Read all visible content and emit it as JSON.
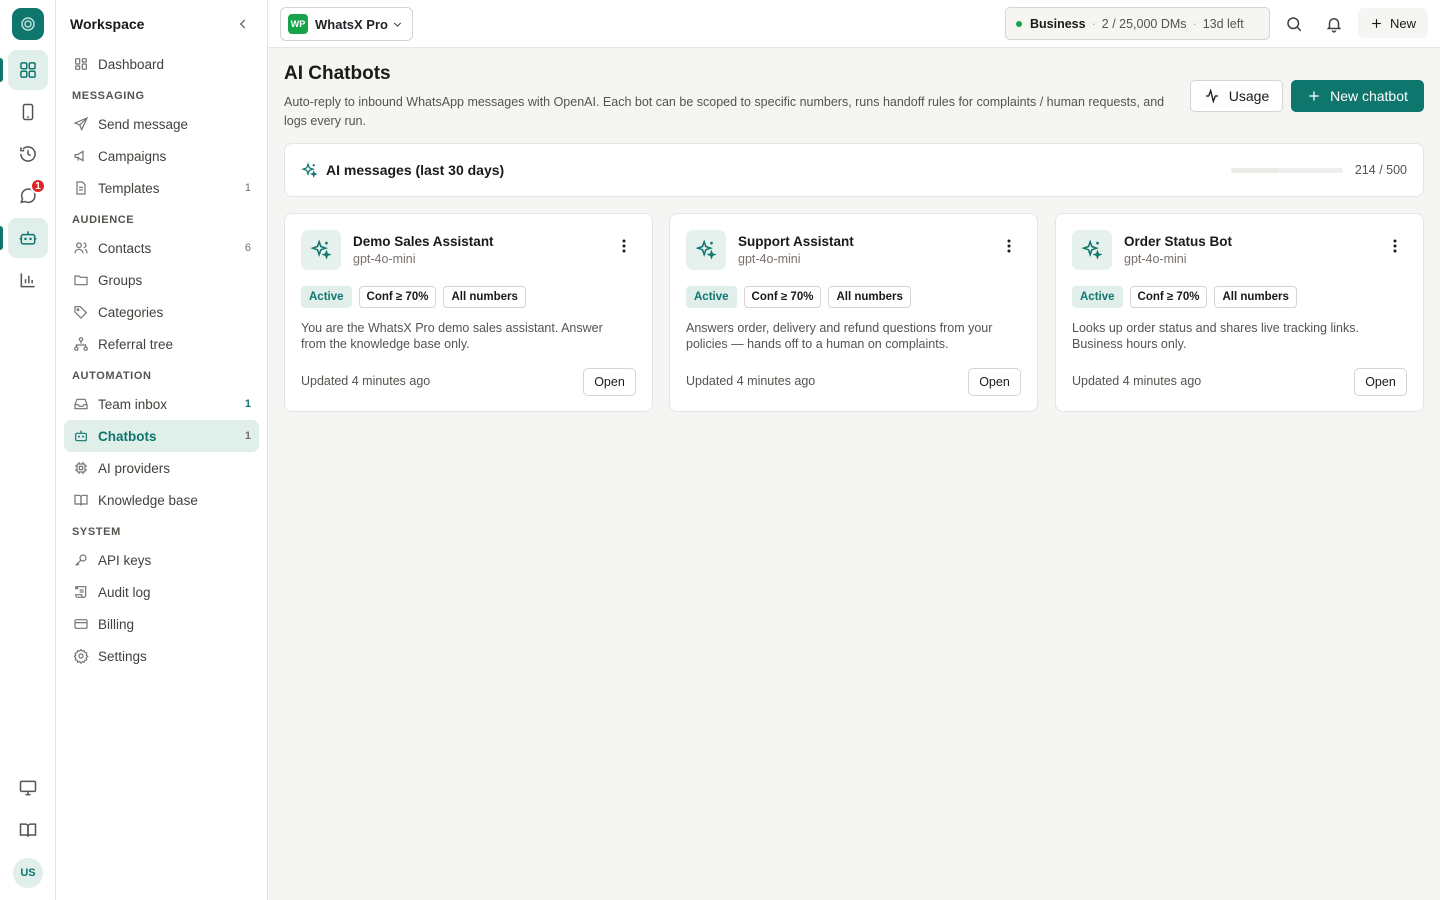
{
  "rail": {
    "badge_count": "1",
    "avatar_initials": "US",
    "items": [
      {
        "icon": "dashboard-grid-icon"
      },
      {
        "icon": "phone-device-icon"
      },
      {
        "icon": "history-icon"
      },
      {
        "icon": "chat-icon"
      },
      {
        "icon": "bot-icon"
      },
      {
        "icon": "bar-chart-icon"
      }
    ]
  },
  "sidebar": {
    "title": "Workspace",
    "dashboard": "Dashboard",
    "sections": {
      "messaging": "MESSAGING",
      "audience": "AUDIENCE",
      "automation": "AUTOMATION",
      "system": "SYSTEM"
    },
    "items": {
      "send_message": "Send message",
      "campaigns": "Campaigns",
      "templates": "Templates",
      "templates_count": "1",
      "contacts": "Contacts",
      "contacts_count": "6",
      "groups": "Groups",
      "categories": "Categories",
      "referral_tree": "Referral tree",
      "team_inbox": "Team inbox",
      "team_inbox_count": "1",
      "chatbots": "Chatbots",
      "chatbots_count": "1",
      "ai_providers": "AI providers",
      "knowledge_base": "Knowledge base",
      "api_keys": "API keys",
      "audit_log": "Audit log",
      "billing": "Billing",
      "settings": "Settings"
    }
  },
  "topbar": {
    "workspace_logo": "WP",
    "workspace_name": "WhatsX Pro",
    "plan_name": "Business",
    "plan_dms": "2 / 25,000 DMs",
    "plan_left": "13d left",
    "new_label": "New"
  },
  "page": {
    "title": "AI Chatbots",
    "description": "Auto-reply to inbound WhatsApp messages with OpenAI. Each bot can be scoped to specific numbers, runs handoff rules for complaints / human requests, and logs every run.",
    "usage_button": "Usage",
    "new_chatbot_button": "New chatbot"
  },
  "usage": {
    "title": "AI messages (last 30 days)",
    "count_label": "214 / 500",
    "used": 214,
    "limit": 500
  },
  "bots": [
    {
      "name": "Demo Sales Assistant",
      "model": "gpt-4o-mini",
      "status": "Active",
      "confidence": "Conf ≥ 70%",
      "scope": "All numbers",
      "description": "You are the WhatsX Pro demo sales assistant. Answer from the knowledge base only.",
      "updated": "Updated 4 minutes ago",
      "open": "Open"
    },
    {
      "name": "Support Assistant",
      "model": "gpt-4o-mini",
      "status": "Active",
      "confidence": "Conf ≥ 70%",
      "scope": "All numbers",
      "description": "Answers order, delivery and refund questions from your policies — hands off to a human on complaints.",
      "updated": "Updated 4 minutes ago",
      "open": "Open"
    },
    {
      "name": "Order Status Bot",
      "model": "gpt-4o-mini",
      "status": "Active",
      "confidence": "Conf ≥ 70%",
      "scope": "All numbers",
      "description": "Looks up order status and shares live tracking links. Business hours only.",
      "updated": "Updated 4 minutes ago",
      "open": "Open"
    }
  ],
  "colors": {
    "brand": "#0f766e",
    "active_bg": "#e0efea",
    "badge": "#dc2626"
  }
}
